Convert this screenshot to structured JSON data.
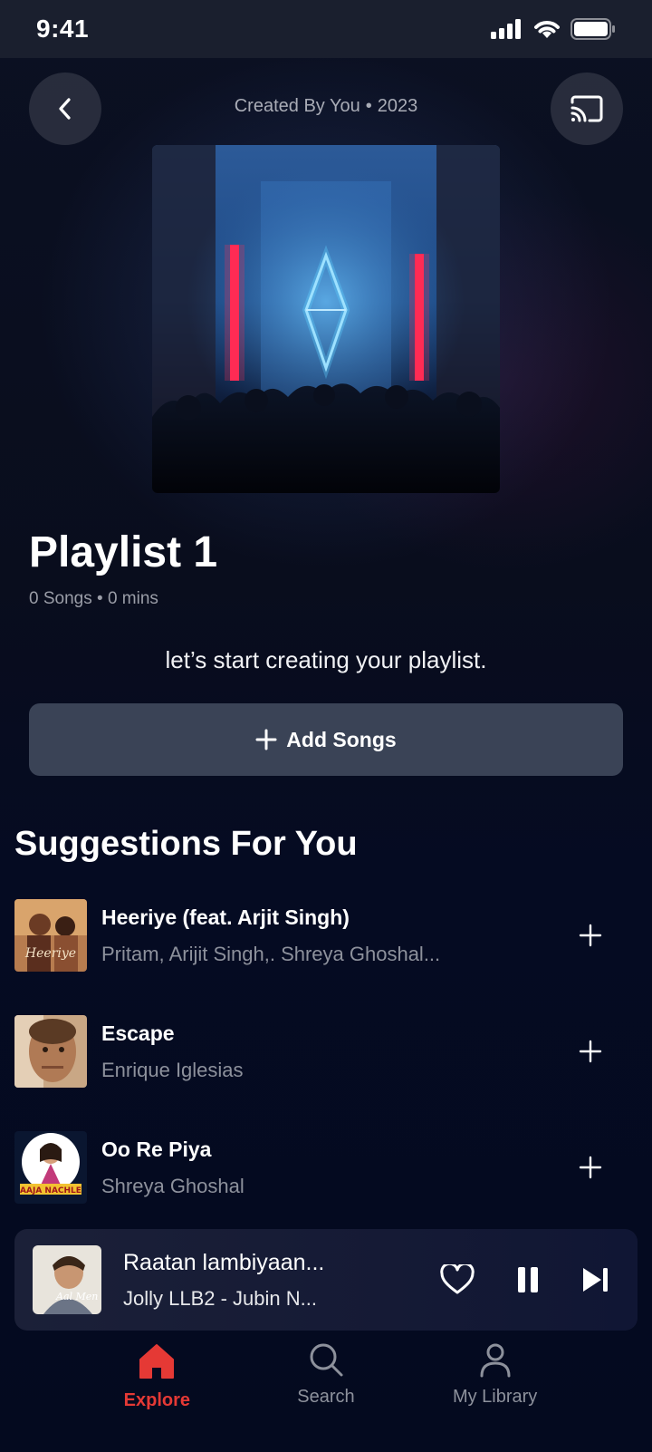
{
  "status_bar": {
    "time": "9:41"
  },
  "header": {
    "created_by": "Created By You",
    "year": "2023"
  },
  "playlist": {
    "title": "Playlist 1",
    "songs_count": "0 Songs",
    "duration": "0 mins",
    "empty_prompt": "let’s start creating your playlist.",
    "add_songs_label": "Add Songs"
  },
  "suggestions": {
    "title": "Suggestions For You",
    "items": [
      {
        "title": "Heeriye (feat. Arjit Singh)",
        "artist": "Pritam, Arijit Singh,. Shreya Ghoshal..."
      },
      {
        "title": "Escape",
        "artist": "Enrique Iglesias"
      },
      {
        "title": "Oo Re Piya",
        "artist": "Shreya Ghoshal"
      }
    ]
  },
  "now_playing": {
    "title": "Raatan lambiyaan...",
    "subtitle": "Jolly LLB2 - Jubin N..."
  },
  "bottom_nav": {
    "items": [
      {
        "label": "Explore",
        "icon": "home-icon",
        "active": true
      },
      {
        "label": "Search",
        "icon": "search-icon",
        "active": false
      },
      {
        "label": "My Library",
        "icon": "user-icon",
        "active": false
      }
    ]
  },
  "colors": {
    "accent": "#e53935",
    "background": "#040a1f",
    "button": "#3a4356"
  }
}
